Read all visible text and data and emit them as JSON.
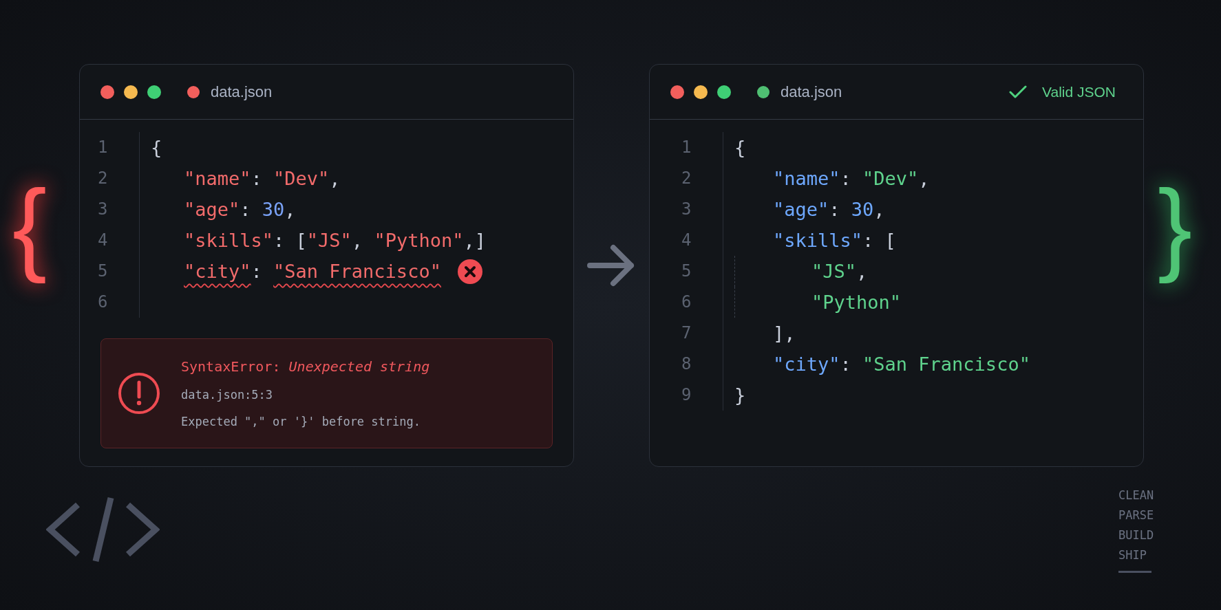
{
  "editors": [
    {
      "kind": "error",
      "file_name": "data.json",
      "lines": [
        {
          "number": "1",
          "tokens": [
            {
              "kind": "punct",
              "text": "{"
            }
          ]
        },
        {
          "number": "2",
          "tokens": [
            {
              "kind": "key",
              "text": "\"name\""
            },
            {
              "kind": "punct",
              "text": ": "
            },
            {
              "kind": "string",
              "text": "\"Dev\""
            },
            {
              "kind": "punct",
              "text": ","
            }
          ]
        },
        {
          "number": "3",
          "tokens": [
            {
              "kind": "key",
              "text": "\"age\""
            },
            {
              "kind": "punct",
              "text": ": "
            },
            {
              "kind": "number",
              "text": "30"
            },
            {
              "kind": "punct",
              "text": ","
            }
          ]
        },
        {
          "number": "4",
          "tokens": [
            {
              "kind": "key",
              "text": "\"skills\""
            },
            {
              "kind": "punct",
              "text": ": ["
            },
            {
              "kind": "string",
              "text": "\"JS\""
            },
            {
              "kind": "punct",
              "text": ", "
            },
            {
              "kind": "string",
              "text": "\"Python\""
            },
            {
              "kind": "punct",
              "text": ",]"
            }
          ]
        },
        {
          "number": "5",
          "error_marker": true,
          "tokens": [
            {
              "kind": "key",
              "text": "\"city\"",
              "squiggle": true
            },
            {
              "kind": "punct",
              "text": ": "
            },
            {
              "kind": "string",
              "text": "\"San Francisco\"",
              "squiggle": true
            }
          ]
        },
        {
          "number": "6"
        }
      ],
      "error": {
        "title": "SyntaxError: *Unexpected string*",
        "location": "data.json:5:3",
        "message": "Expected \",\" or '}' before string."
      }
    },
    {
      "kind": "valid",
      "file_name": "data.json",
      "status_text": "Valid JSON",
      "lines": [
        {
          "number": "1",
          "tokens": [
            {
              "kind": "punct",
              "text": "{"
            }
          ]
        },
        {
          "number": "2",
          "tokens": [
            {
              "kind": "key",
              "text": "\"name\""
            },
            {
              "kind": "punct",
              "text": ": "
            },
            {
              "kind": "string",
              "text": "\"Dev\""
            },
            {
              "kind": "punct",
              "text": ","
            }
          ]
        },
        {
          "number": "3",
          "tokens": [
            {
              "kind": "key",
              "text": "\"age\""
            },
            {
              "kind": "punct",
              "text": ": "
            },
            {
              "kind": "number",
              "text": "30"
            },
            {
              "kind": "punct",
              "text": ","
            }
          ]
        },
        {
          "number": "4",
          "tokens": [
            {
              "kind": "key",
              "text": "\"skills\""
            },
            {
              "kind": "punct",
              "text": ": ["
            }
          ]
        },
        {
          "number": "5",
          "tokens": [
            {
              "kind": "string",
              "text": "\"JS\""
            },
            {
              "kind": "punct",
              "text": ","
            }
          ]
        },
        {
          "number": "6",
          "tokens": [
            {
              "kind": "string",
              "text": "\"Python\""
            }
          ]
        },
        {
          "number": "7",
          "tokens": [
            {
              "kind": "punct",
              "text": "],"
            }
          ]
        },
        {
          "number": "8",
          "tokens": [
            {
              "kind": "key",
              "text": "\"city\""
            },
            {
              "kind": "punct",
              "text": ": "
            },
            {
              "kind": "string",
              "text": "\"San Francisco\""
            }
          ]
        },
        {
          "number": "9",
          "tokens": [
            {
              "kind": "punct",
              "text": "}"
            }
          ]
        }
      ]
    }
  ],
  "decor": {
    "left_brace": "{",
    "right_brace": "}",
    "steps": [
      "CLEAN",
      "PARSE",
      "BUILD",
      "SHIP"
    ]
  }
}
